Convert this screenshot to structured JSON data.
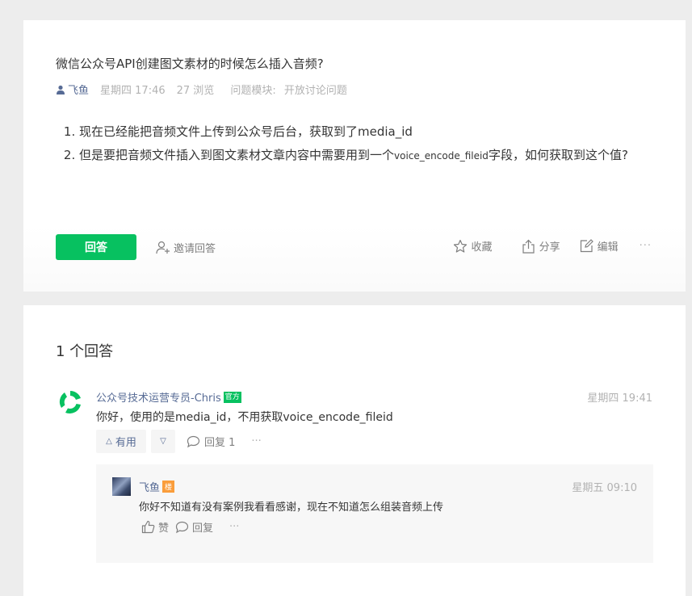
{
  "question": {
    "title": "微信公众号API创建图文素材的时候怎么插入音频?",
    "author": "飞鱼",
    "time": "星期四 17:46",
    "views": "27 浏览",
    "module_label": "问题模块:",
    "module_value": "开放讨论问题",
    "body": {
      "item1": "现在已经能把音频文件上传到公众号后台，获取到了media_id",
      "item2_prefix": "但是要把音频文件插入到图文素材文章内容中需要用到一个",
      "item2_code": "voice_encode_fileid",
      "item2_suffix": "字段，如何获取到这个值?"
    },
    "answer_button": "回答",
    "invite": "邀请回答",
    "favorite": "收藏",
    "share": "分享",
    "edit": "编辑",
    "more": "···"
  },
  "answers": {
    "count_label": "1 个回答",
    "items": [
      {
        "author": "公众号技术运营专员-Chris",
        "badge": "官方",
        "time": "星期四 19:41",
        "text": "你好，使用的是media_id，不用获取voice_encode_fileid",
        "useful": "有用",
        "reply": "回复 1",
        "more": "···",
        "comment": {
          "author": "飞鱼",
          "badge": "楼",
          "time": "星期五 09:10",
          "text": "你好不知道有没有案例我看看感谢，现在不知道怎么组装音频上传",
          "like": "赞",
          "reply": "回复",
          "more": "···"
        }
      }
    ]
  },
  "colors": {
    "accent": "#07c160",
    "link": "#576b95",
    "muted": "#b2b2b2",
    "op_badge": "#fa9d3b"
  }
}
